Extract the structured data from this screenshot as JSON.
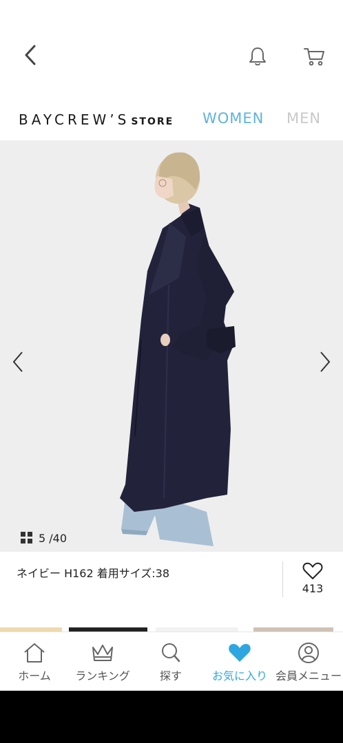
{
  "header": {
    "back_icon": "chevron-left-icon",
    "notification_icon": "bell-icon",
    "cart_icon": "cart-icon"
  },
  "brand": {
    "logo_main": "BAYCREW’S",
    "logo_sub": "STORE",
    "tabs": [
      {
        "label": "WOMEN",
        "active": true,
        "color": "#5fb3de"
      },
      {
        "label": "MEN",
        "active": false,
        "color": "#c9c9c9"
      }
    ]
  },
  "gallery": {
    "image_description_icon": "photo",
    "counter_text": "5 /40",
    "current_index": 5,
    "total": 40
  },
  "product": {
    "color_info": "ネイビー H162 着用サイズ:38",
    "favorite_count": "413"
  },
  "bottom_nav": {
    "items": [
      {
        "label": "ホーム",
        "icon": "home-icon",
        "active": false
      },
      {
        "label": "ランキング",
        "icon": "crown-icon",
        "active": false
      },
      {
        "label": "探す",
        "icon": "search-icon",
        "active": false
      },
      {
        "label": "お気に入り",
        "icon": "heart-icon",
        "active": true
      },
      {
        "label": "会員メニュー",
        "icon": "user-icon",
        "active": false
      }
    ]
  },
  "colors": {
    "accent": "#2ea7e0",
    "women_tab": "#5fb3de",
    "image_bg": "#eeeeee",
    "coat": "#22233a"
  }
}
